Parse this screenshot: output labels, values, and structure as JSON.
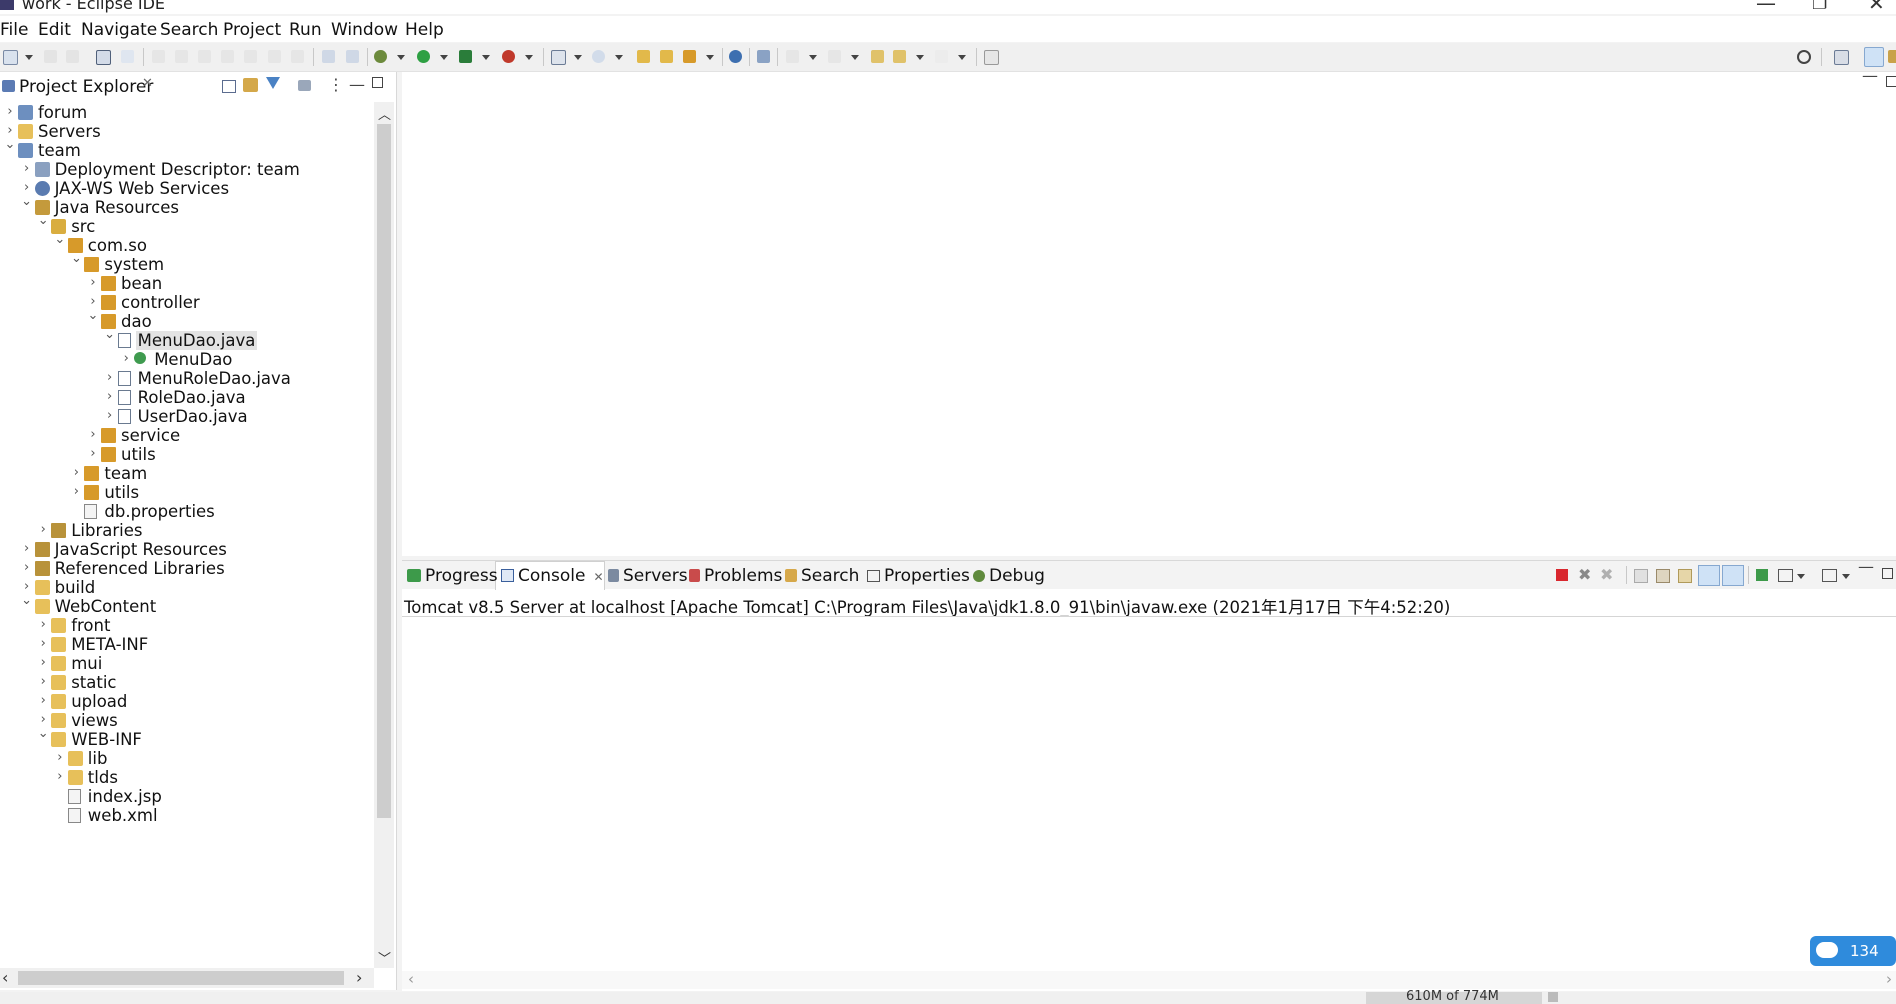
{
  "window": {
    "title": "work - Eclipse IDE",
    "controls": [
      "minimize",
      "restore",
      "close"
    ]
  },
  "menu": [
    "File",
    "Edit",
    "Navigate",
    "Search",
    "Project",
    "Run",
    "Window",
    "Help"
  ],
  "explorer": {
    "tab_label": "Project Explorer",
    "tree": [
      {
        "label": "forum",
        "depth": 0,
        "chevron": "collapsed",
        "icon": "project-icon"
      },
      {
        "label": "Servers",
        "depth": 0,
        "chevron": "collapsed",
        "icon": "folder-icon"
      },
      {
        "label": "team",
        "depth": 0,
        "chevron": "expanded",
        "icon": "project-icon"
      },
      {
        "label": "Deployment Descriptor: team",
        "depth": 1,
        "chevron": "collapsed",
        "icon": "descriptor-icon"
      },
      {
        "label": "JAX-WS Web Services",
        "depth": 1,
        "chevron": "collapsed",
        "icon": "webservice-icon"
      },
      {
        "label": "Java Resources",
        "depth": 1,
        "chevron": "expanded",
        "icon": "java-resources-icon"
      },
      {
        "label": "src",
        "depth": 2,
        "chevron": "expanded",
        "icon": "source-folder-icon"
      },
      {
        "label": "com.so",
        "depth": 3,
        "chevron": "expanded",
        "icon": "package-icon"
      },
      {
        "label": "system",
        "depth": 4,
        "chevron": "expanded",
        "icon": "package-icon"
      },
      {
        "label": "bean",
        "depth": 5,
        "chevron": "collapsed",
        "icon": "package-icon"
      },
      {
        "label": "controller",
        "depth": 5,
        "chevron": "collapsed",
        "icon": "package-icon"
      },
      {
        "label": "dao",
        "depth": 5,
        "chevron": "expanded",
        "icon": "package-icon"
      },
      {
        "label": "MenuDao.java",
        "depth": 6,
        "chevron": "expanded",
        "icon": "java-file-icon",
        "selected": true
      },
      {
        "label": "MenuDao",
        "depth": 7,
        "chevron": "collapsed",
        "icon": "class-icon"
      },
      {
        "label": "MenuRoleDao.java",
        "depth": 6,
        "chevron": "collapsed",
        "icon": "java-file-icon"
      },
      {
        "label": "RoleDao.java",
        "depth": 6,
        "chevron": "collapsed",
        "icon": "java-file-icon"
      },
      {
        "label": "UserDao.java",
        "depth": 6,
        "chevron": "collapsed",
        "icon": "java-file-icon"
      },
      {
        "label": "service",
        "depth": 5,
        "chevron": "collapsed",
        "icon": "package-icon"
      },
      {
        "label": "utils",
        "depth": 5,
        "chevron": "collapsed",
        "icon": "package-icon"
      },
      {
        "label": "team",
        "depth": 4,
        "chevron": "collapsed",
        "icon": "package-icon"
      },
      {
        "label": "utils",
        "depth": 4,
        "chevron": "collapsed",
        "icon": "package-icon"
      },
      {
        "label": "db.properties",
        "depth": 4,
        "chevron": "none",
        "icon": "properties-file-icon"
      },
      {
        "label": "Libraries",
        "depth": 2,
        "chevron": "collapsed",
        "icon": "library-icon"
      },
      {
        "label": "JavaScript Resources",
        "depth": 1,
        "chevron": "collapsed",
        "icon": "library-icon"
      },
      {
        "label": "Referenced Libraries",
        "depth": 1,
        "chevron": "collapsed",
        "icon": "library-icon"
      },
      {
        "label": "build",
        "depth": 1,
        "chevron": "collapsed",
        "icon": "folder-icon"
      },
      {
        "label": "WebContent",
        "depth": 1,
        "chevron": "expanded",
        "icon": "folder-icon"
      },
      {
        "label": "front",
        "depth": 2,
        "chevron": "collapsed",
        "icon": "folder-icon"
      },
      {
        "label": "META-INF",
        "depth": 2,
        "chevron": "collapsed",
        "icon": "folder-icon"
      },
      {
        "label": "mui",
        "depth": 2,
        "chevron": "collapsed",
        "icon": "folder-icon"
      },
      {
        "label": "static",
        "depth": 2,
        "chevron": "collapsed",
        "icon": "folder-icon"
      },
      {
        "label": "upload",
        "depth": 2,
        "chevron": "collapsed",
        "icon": "folder-icon"
      },
      {
        "label": "views",
        "depth": 2,
        "chevron": "collapsed",
        "icon": "folder-icon"
      },
      {
        "label": "WEB-INF",
        "depth": 2,
        "chevron": "expanded",
        "icon": "folder-icon"
      },
      {
        "label": "lib",
        "depth": 3,
        "chevron": "collapsed",
        "icon": "folder-icon"
      },
      {
        "label": "tlds",
        "depth": 3,
        "chevron": "collapsed",
        "icon": "folder-icon"
      },
      {
        "label": "index.jsp",
        "depth": 3,
        "chevron": "none",
        "icon": "jsp-file-icon"
      },
      {
        "label": "web.xml",
        "depth": 3,
        "chevron": "none",
        "icon": "xml-file-icon"
      }
    ]
  },
  "bottom_panel": {
    "tabs": [
      {
        "label": "Progress",
        "icon": "progress-icon"
      },
      {
        "label": "Console",
        "icon": "console-icon",
        "active": true
      },
      {
        "label": "Servers",
        "icon": "servers-icon"
      },
      {
        "label": "Problems",
        "icon": "problems-icon"
      },
      {
        "label": "Search",
        "icon": "search-icon"
      },
      {
        "label": "Properties",
        "icon": "properties-icon"
      },
      {
        "label": "Debug",
        "icon": "debug-icon"
      }
    ],
    "console_description": "Tomcat v8.5 Server at localhost [Apache Tomcat] C:\\Program Files\\Java\\jdk1.8.0_91\\bin\\javaw.exe (2021年1月17日 下午4:52:20)"
  },
  "status": {
    "heap": "610M of 774M",
    "cloud_badge": "134"
  },
  "colors": {
    "accent": "#2f8bdc",
    "terminate_red": "#d9272e",
    "selection": "#e3e3e3"
  }
}
